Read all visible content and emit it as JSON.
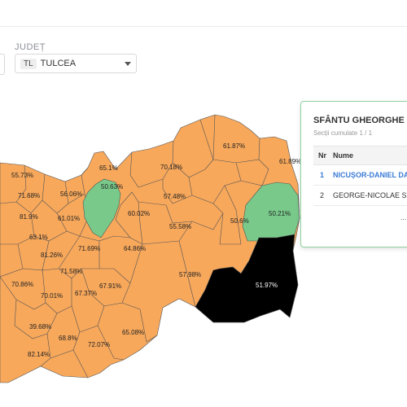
{
  "header": {
    "county_label": "JUDEȚ",
    "county_code": "TL",
    "county_name": "TULCEA"
  },
  "colors": {
    "orange": "#f8a85b",
    "green": "#78c98a",
    "black": "#000000",
    "border": "#555555"
  },
  "map": {
    "labels": [
      {
        "text": "55.73%",
        "color": "orange"
      },
      {
        "text": "65.1%",
        "color": "orange"
      },
      {
        "text": "70.18%",
        "color": "orange"
      },
      {
        "text": "61.87%",
        "color": "orange"
      },
      {
        "text": "61.89%",
        "color": "orange"
      },
      {
        "text": "71.68%",
        "color": "orange"
      },
      {
        "text": "56.06%",
        "color": "orange"
      },
      {
        "text": "50.63%",
        "color": "green"
      },
      {
        "text": "57.48%",
        "color": "orange"
      },
      {
        "text": "50.21%",
        "color": "green"
      },
      {
        "text": "81.9%",
        "color": "orange"
      },
      {
        "text": "61.01%",
        "color": "orange"
      },
      {
        "text": "60.02%",
        "color": "orange"
      },
      {
        "text": "55.58%",
        "color": "orange"
      },
      {
        "text": "50.6%",
        "color": "orange"
      },
      {
        "text": "63.1%",
        "color": "orange"
      },
      {
        "text": "71.69%",
        "color": "orange"
      },
      {
        "text": "64.86%",
        "color": "orange"
      },
      {
        "text": "81.26%",
        "color": "orange"
      },
      {
        "text": "71.58%",
        "color": "orange"
      },
      {
        "text": "57.98%",
        "color": "orange"
      },
      {
        "text": "51.97%",
        "color": "black"
      },
      {
        "text": "70.86%",
        "color": "orange"
      },
      {
        "text": "70.01%",
        "color": "orange"
      },
      {
        "text": "67.37%",
        "color": "orange"
      },
      {
        "text": "67.91%",
        "color": "orange"
      },
      {
        "text": "39.68%",
        "color": "orange"
      },
      {
        "text": "68.8%",
        "color": "orange"
      },
      {
        "text": "65.08%",
        "color": "orange"
      },
      {
        "text": "72.07%",
        "color": "orange"
      },
      {
        "text": "82.14%",
        "color": "orange"
      }
    ]
  },
  "tooltip": {
    "title": "SFÂNTU GHEORGHE",
    "subtitle": "Secții cumulate 1 / 1",
    "col_nr": "Nr",
    "col_name": "Nume",
    "rows": [
      {
        "nr": "1",
        "name": "NICUȘOR-DANIEL DAN"
      },
      {
        "nr": "2",
        "name": "GEORGE-NICOLAE SIMION"
      }
    ],
    "more": "..."
  }
}
